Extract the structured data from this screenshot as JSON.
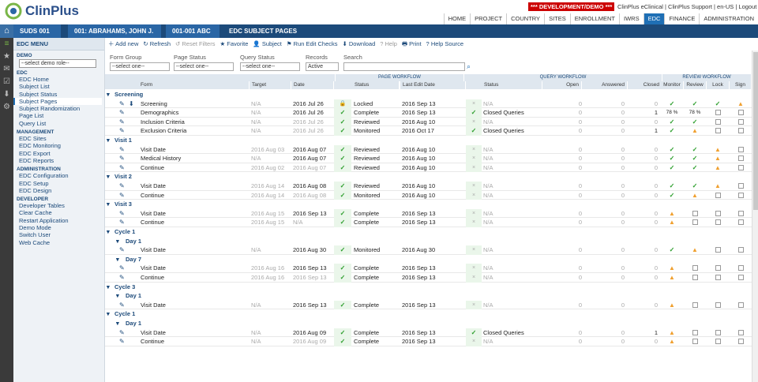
{
  "brand": {
    "name": "ClinPlus"
  },
  "banner": {
    "dev": "*** DEVELOPMENT/DEMO ***"
  },
  "toplinks": "ClinPlus eClinical | ClinPlus Support | en-US | Logout",
  "mainnav": [
    "HOME",
    "PROJECT",
    "COUNTRY",
    "SITES",
    "ENROLLMENT",
    "IWRS",
    "EDC",
    "FINANCE",
    "ADMINISTRATION"
  ],
  "mainnav_active": "EDC",
  "breadcrumb": [
    "SUDS 001",
    "001: ABRAHAMS, JOHN J.",
    "001-001 ABC",
    "EDC SUBJECT PAGES"
  ],
  "sidebar": {
    "title": "EDC MENU",
    "demo_label": "DEMO",
    "demo_select": "--select demo role--",
    "sections": [
      {
        "name": "EDC",
        "items": [
          "EDC Home",
          "Subject List",
          "Subject Status",
          "Subject Pages",
          "Subject Randomization",
          "Page List",
          "Query List"
        ]
      },
      {
        "name": "MANAGEMENT",
        "items": [
          "EDC Sites",
          "EDC Monitoring",
          "EDC Export",
          "EDC Reports"
        ]
      },
      {
        "name": "ADMINISTRATION",
        "items": [
          "EDC Configuration",
          "EDC Setup",
          "EDC Design"
        ]
      },
      {
        "name": "DEVELOPER",
        "items": [
          "Developer Tables",
          "Clear Cache",
          "Restart Application",
          "Demo Mode",
          "Switch User",
          "Web Cache"
        ]
      }
    ],
    "selected": "Subject Pages"
  },
  "toolbar": [
    "Add new",
    "Refresh",
    "Reset Filters",
    "Favorite",
    "Subject",
    "Run Edit Checks",
    "Download",
    "Help",
    "Print",
    "Help Source"
  ],
  "filters": {
    "form_group": {
      "label": "Form Group",
      "value": "--select one--"
    },
    "page_status": {
      "label": "Page Status",
      "value": "--select one--"
    },
    "query_status": {
      "label": "Query Status",
      "value": "--select one--"
    },
    "records": {
      "label": "Records",
      "value": "Active"
    },
    "search": {
      "label": "Search",
      "value": ""
    }
  },
  "headers": {
    "page_workflow": "PAGE WORKFLOW",
    "query_workflow": "QUERY WORKFLOW",
    "review_workflow": "REVIEW WORKFLOW",
    "cols": [
      "Form",
      "Target",
      "Date",
      "Status",
      "Last Edit Date",
      "Status",
      "Open",
      "Answered",
      "Closed",
      "Monitor",
      "Review",
      "Lock",
      "Sign"
    ]
  },
  "rows": [
    {
      "g": "Screening",
      "lvl": 0
    },
    {
      "form": "Screening",
      "target": "N/A",
      "date": "2016 Jul 26",
      "ps": "lock",
      "status": "Locked",
      "edit": "2016 Sep 13",
      "qs": "x",
      "qstatus": "N/A",
      "open": "0",
      "ans": "0",
      "closed": "0",
      "mon": "chk",
      "rev": "chk",
      "lock": "chk",
      "sign": "warn",
      "dl": true
    },
    {
      "form": "Demographics",
      "target": "N/A",
      "date": "2016 Jul 26",
      "ps": "chk",
      "status": "Complete",
      "edit": "2016 Sep 13",
      "qs": "chk",
      "qstatus": "Closed Queries",
      "open": "0",
      "ans": "0",
      "closed": "1",
      "mon": "78 %",
      "rev": "78 %",
      "lock": "box",
      "sign": "box"
    },
    {
      "form": "Inclusion Criteria",
      "target": "N/A",
      "date": "2016 Jul 26",
      "dgray": true,
      "ps": "chk",
      "status": "Reviewed",
      "edit": "2016 Aug 10",
      "qs": "x",
      "qstatus": "N/A",
      "open": "0",
      "ans": "0",
      "closed": "0",
      "mon": "chk",
      "rev": "chk",
      "lock": "box",
      "sign": "box"
    },
    {
      "form": "Exclusion Criteria",
      "target": "N/A",
      "date": "2016 Jul 26",
      "dgray": true,
      "ps": "chk",
      "status": "Monitored",
      "edit": "2016 Oct 17",
      "qs": "chk",
      "qstatus": "Closed Queries",
      "open": "0",
      "ans": "0",
      "closed": "1",
      "mon": "chk",
      "rev": "warn",
      "lock": "box",
      "sign": "box"
    },
    {
      "g": "Visit 1",
      "lvl": 0
    },
    {
      "form": "Visit Date",
      "target": "2016 Aug 03",
      "date": "2016 Aug 07",
      "ps": "chk",
      "status": "Reviewed",
      "edit": "2016 Aug 10",
      "qs": "x",
      "qstatus": "N/A",
      "open": "0",
      "ans": "0",
      "closed": "0",
      "mon": "chk",
      "rev": "chk",
      "lock": "warn",
      "sign": "box"
    },
    {
      "form": "Medical History",
      "target": "N/A",
      "date": "2016 Aug 07",
      "ps": "chk",
      "status": "Reviewed",
      "edit": "2016 Aug 10",
      "qs": "x",
      "qstatus": "N/A",
      "open": "0",
      "ans": "0",
      "closed": "0",
      "mon": "chk",
      "rev": "chk",
      "lock": "warn",
      "sign": "box"
    },
    {
      "form": "Continue",
      "target": "2016 Aug 02",
      "date": "2016 Aug 07",
      "dgray": true,
      "ps": "chk",
      "status": "Reviewed",
      "edit": "2016 Aug 10",
      "qs": "x",
      "qstatus": "N/A",
      "open": "0",
      "ans": "0",
      "closed": "0",
      "mon": "chk",
      "rev": "chk",
      "lock": "warn",
      "sign": "box"
    },
    {
      "g": "Visit 2",
      "lvl": 0
    },
    {
      "form": "Visit Date",
      "target": "2016 Aug 14",
      "date": "2016 Aug 08",
      "ps": "chk",
      "status": "Reviewed",
      "edit": "2016 Aug 10",
      "qs": "x",
      "qstatus": "N/A",
      "open": "0",
      "ans": "0",
      "closed": "0",
      "mon": "chk",
      "rev": "chk",
      "lock": "warn",
      "sign": "box"
    },
    {
      "form": "Continue",
      "target": "2016 Aug 14",
      "date": "2016 Aug 08",
      "dgray": true,
      "ps": "chk",
      "status": "Monitored",
      "edit": "2016 Aug 10",
      "qs": "x",
      "qstatus": "N/A",
      "open": "0",
      "ans": "0",
      "closed": "0",
      "mon": "chk",
      "rev": "warn",
      "lock": "box",
      "sign": "box"
    },
    {
      "g": "Visit 3",
      "lvl": 0
    },
    {
      "form": "Visit Date",
      "target": "2016 Aug 15",
      "date": "2016 Sep 13",
      "ps": "chk",
      "status": "Complete",
      "edit": "2016 Sep 13",
      "qs": "x",
      "qstatus": "N/A",
      "open": "0",
      "ans": "0",
      "closed": "0",
      "mon": "warn",
      "rev": "box",
      "lock": "box",
      "sign": "box"
    },
    {
      "form": "Continue",
      "target": "2016 Aug 15",
      "date": "N/A",
      "dgray": true,
      "ps": "chk",
      "status": "Complete",
      "edit": "2016 Sep 13",
      "qs": "x",
      "qstatus": "N/A",
      "open": "0",
      "ans": "0",
      "closed": "0",
      "mon": "warn",
      "rev": "box",
      "lock": "box",
      "sign": "box"
    },
    {
      "g": "Cycle 1",
      "lvl": 0
    },
    {
      "g": "Day 1",
      "lvl": 1
    },
    {
      "form": "Visit Date",
      "target": "N/A",
      "date": "2016 Aug 30",
      "ps": "chk",
      "status": "Monitored",
      "edit": "2016 Aug 30",
      "qs": "x",
      "qstatus": "N/A",
      "open": "0",
      "ans": "0",
      "closed": "0",
      "mon": "chk",
      "rev": "warn",
      "lock": "box",
      "sign": "box"
    },
    {
      "g": "Day 7",
      "lvl": 1
    },
    {
      "form": "Visit Date",
      "target": "2016 Aug 16",
      "date": "2016 Sep 13",
      "ps": "chk",
      "status": "Complete",
      "edit": "2016 Sep 13",
      "qs": "x",
      "qstatus": "N/A",
      "open": "0",
      "ans": "0",
      "closed": "0",
      "mon": "warn",
      "rev": "box",
      "lock": "box",
      "sign": "box"
    },
    {
      "form": "Continue",
      "target": "2016 Aug 16",
      "date": "2016 Sep 13",
      "dgray": true,
      "ps": "chk",
      "status": "Complete",
      "edit": "2016 Sep 13",
      "qs": "x",
      "qstatus": "N/A",
      "open": "0",
      "ans": "0",
      "closed": "0",
      "mon": "warn",
      "rev": "box",
      "lock": "box",
      "sign": "box"
    },
    {
      "g": "Cycle 3",
      "lvl": 0
    },
    {
      "g": "Day 1",
      "lvl": 1
    },
    {
      "form": "Visit Date",
      "target": "N/A",
      "date": "2016 Sep 13",
      "ps": "chk",
      "status": "Complete",
      "edit": "2016 Sep 13",
      "qs": "x",
      "qstatus": "N/A",
      "open": "0",
      "ans": "0",
      "closed": "0",
      "mon": "warn",
      "rev": "box",
      "lock": "box",
      "sign": "box"
    },
    {
      "g": "Cycle 1",
      "lvl": 0
    },
    {
      "g": "Day 1",
      "lvl": 1
    },
    {
      "form": "Visit Date",
      "target": "N/A",
      "date": "2016 Aug 09",
      "ps": "chk",
      "status": "Complete",
      "edit": "2016 Sep 13",
      "qs": "chk",
      "qstatus": "Closed Queries",
      "open": "0",
      "ans": "0",
      "closed": "1",
      "mon": "warn",
      "rev": "box",
      "lock": "box",
      "sign": "box"
    },
    {
      "form": "Continue",
      "target": "N/A",
      "date": "2016 Aug 09",
      "dgray": true,
      "ps": "chk",
      "status": "Complete",
      "edit": "2016 Sep 13",
      "qs": "x",
      "qstatus": "N/A",
      "open": "0",
      "ans": "0",
      "closed": "0",
      "mon": "warn",
      "rev": "box",
      "lock": "box",
      "sign": "box"
    }
  ],
  "colors": {
    "navy": "#1c4a7a",
    "accent": "#1f6fb5",
    "check": "#2a9d2a",
    "warn": "#f0a030",
    "devred": "#cc0000"
  }
}
